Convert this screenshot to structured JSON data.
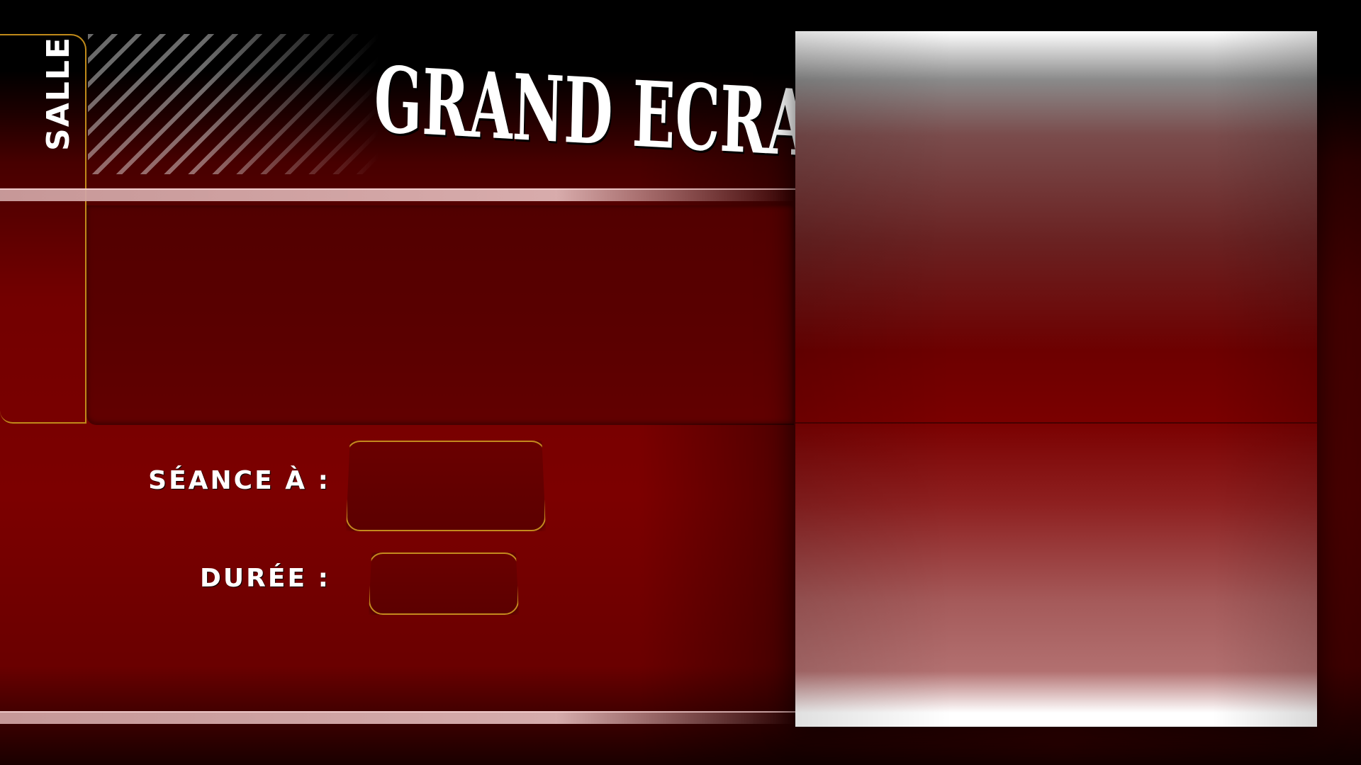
{
  "header": {
    "room_label": "SALLE",
    "title": "GRAND ECRAN"
  },
  "info": {
    "showtime_label": "SÉANCE À :",
    "showtime_value": "",
    "duration_label": "DURÉE :",
    "duration_value": ""
  },
  "colors": {
    "background": "#7c0000",
    "accent_border": "#c08a1a",
    "text": "#ffffff"
  }
}
